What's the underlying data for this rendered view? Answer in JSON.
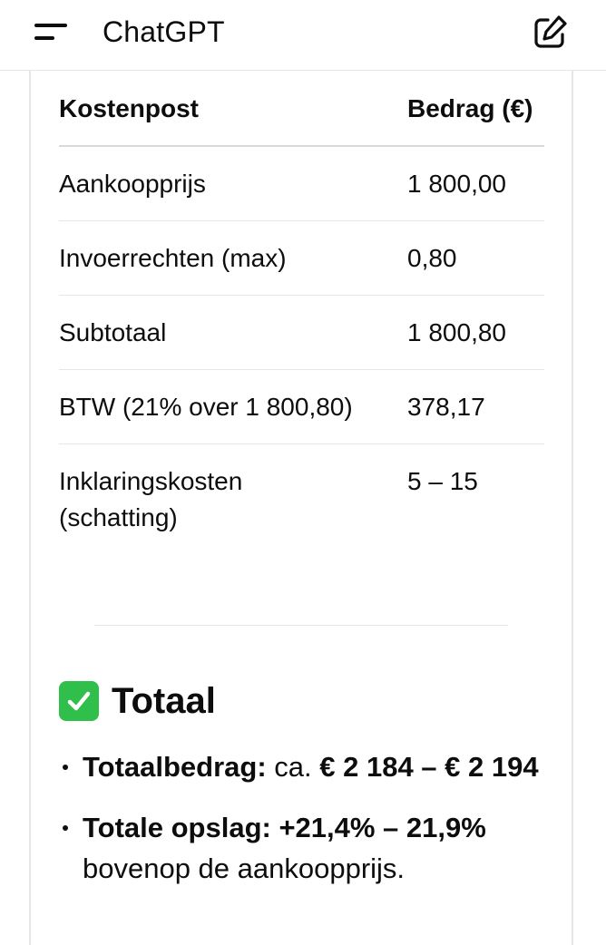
{
  "header": {
    "title": "ChatGPT",
    "menu_icon": "menu-icon",
    "new_chat_icon": "new-chat-icon"
  },
  "table": {
    "columns": [
      "Kostenpost",
      "Bedrag (€)"
    ],
    "rows": [
      {
        "label": "Aankoopprijs",
        "value": "1 800,00"
      },
      {
        "label": "Invoerrechten (max)",
        "value": "0,80"
      },
      {
        "label": "Subtotaal",
        "value": "1 800,80"
      },
      {
        "label": "BTW (21% over 1 800,80)",
        "value": "378,17"
      },
      {
        "label_line1": "Inklaringskosten",
        "label_line2": "(schatting)",
        "value": "5 – 15"
      }
    ]
  },
  "section": {
    "icon": "check-mark-icon",
    "icon_color": "#2fbf4a",
    "title": "Totaal"
  },
  "summary": [
    {
      "bold": "Totaalbedrag:",
      "normal": " ca. ",
      "bold2": "€ 2 184 – € 2 194"
    },
    {
      "bold": "Totale opslag: +21,4% – 21,9%",
      "normal": " bovenop de aankoopprijs."
    }
  ]
}
